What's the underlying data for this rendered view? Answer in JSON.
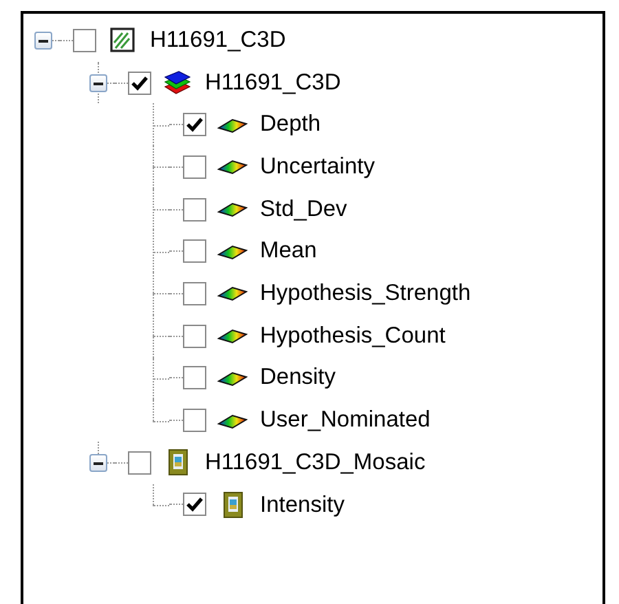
{
  "tree": [
    {
      "label": "H11691_C3D",
      "kind": "hatched",
      "checked": false,
      "expanded": true,
      "children": [
        {
          "label": "H11691_C3D",
          "kind": "layers",
          "checked": true,
          "expanded": true,
          "children": [
            {
              "label": "Depth",
              "kind": "surface",
              "checked": true
            },
            {
              "label": "Uncertainty",
              "kind": "surface",
              "checked": false
            },
            {
              "label": "Std_Dev",
              "kind": "surface",
              "checked": false
            },
            {
              "label": "Mean",
              "kind": "surface",
              "checked": false
            },
            {
              "label": "Hypothesis_Strength",
              "kind": "surface",
              "checked": false
            },
            {
              "label": "Hypothesis_Count",
              "kind": "surface",
              "checked": false
            },
            {
              "label": "Density",
              "kind": "surface",
              "checked": false
            },
            {
              "label": "User_Nominated",
              "kind": "surface",
              "checked": false
            }
          ]
        },
        {
          "label": "H11691_C3D_Mosaic",
          "kind": "image",
          "checked": false,
          "expanded": true,
          "children": [
            {
              "label": "Intensity",
              "kind": "image",
              "checked": true
            }
          ]
        }
      ]
    }
  ]
}
